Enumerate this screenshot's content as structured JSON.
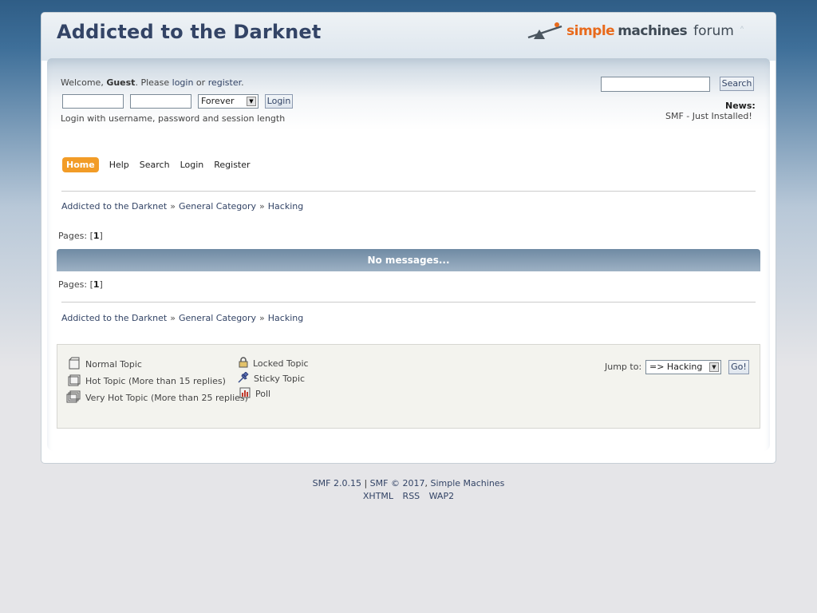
{
  "header": {
    "forum_title": "Addicted to the Darknet",
    "logo_simple": "simple",
    "logo_machines": "machines",
    "logo_forum": "forum",
    "collapse_glyph": "˄"
  },
  "user": {
    "welcome_prefix": "Welcome, ",
    "guest": "Guest",
    "please": ". Please ",
    "login_link": "login",
    "or": " or ",
    "register_link": "register",
    "period": ".",
    "session_value": "Forever",
    "login_button": "Login",
    "login_note": "Login with username, password and session length"
  },
  "search": {
    "button": "Search"
  },
  "news": {
    "label": "News:",
    "text": "SMF - Just Installed!"
  },
  "menu": {
    "items": [
      {
        "label": "Home",
        "active": true
      },
      {
        "label": "Help"
      },
      {
        "label": "Search"
      },
      {
        "label": "Login"
      },
      {
        "label": "Register"
      }
    ]
  },
  "breadcrumb": {
    "items": [
      "Addicted to the Darknet",
      "General Category",
      "Hacking"
    ],
    "separator": "»"
  },
  "pages": {
    "label": "Pages: [",
    "current": "1",
    "close": "]"
  },
  "message_bar": "No messages...",
  "legend": {
    "normal": "Normal Topic",
    "hot": "Hot Topic (More than 15 replies)",
    "very_hot": "Very Hot Topic (More than 25 replies)",
    "locked": "Locked Topic",
    "sticky": "Sticky Topic",
    "poll": "Poll"
  },
  "jump": {
    "label": "Jump to:",
    "selected": "=> Hacking",
    "go": "Go!"
  },
  "footer": {
    "smf_version": "SMF 2.0.15",
    "sep": " | ",
    "copyright": "SMF © 2017",
    "comma": ", ",
    "simple_machines": "Simple Machines",
    "links": [
      "XHTML",
      "RSS",
      "WAP2"
    ]
  }
}
